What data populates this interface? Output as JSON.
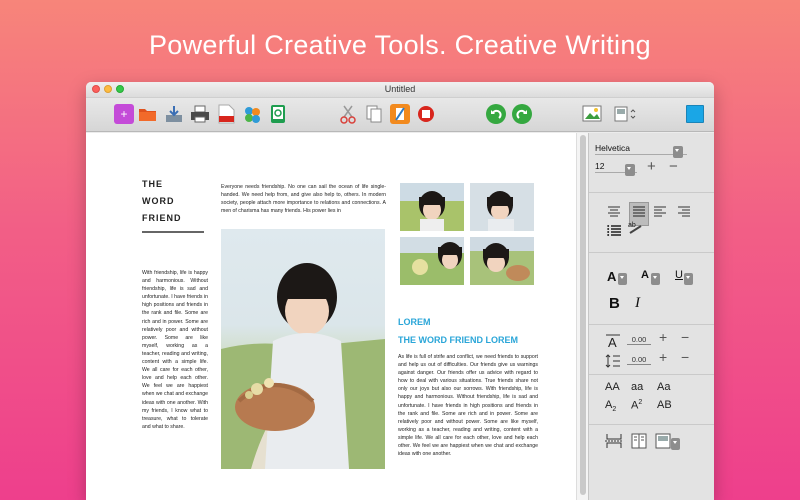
{
  "headline": "Powerful Creative Tools. Creative Writing",
  "window": {
    "title": "Untitled"
  },
  "toolbar": {
    "icons": [
      "new-document-icon",
      "open-folder-icon",
      "import-icon",
      "print-icon",
      "pdf-export-icon",
      "share-icon",
      "save-icon",
      "cut-icon",
      "copy-icon",
      "paste-icon",
      "insert-image-icon",
      "undo-icon",
      "redo-icon",
      "insert-picture-icon",
      "page-setup-icon",
      "color-swatch-icon"
    ],
    "accent": "#1aa6e6"
  },
  "document": {
    "heading_lines": [
      "THE",
      "WORD",
      "FRIEND"
    ],
    "left_column_text": "With friendship, life is happy and harmonious. Without friendship, life is sad and unfortunate. I have friends in high positions and friends in the rank and file. Some are rich and in power. Some are relatively poor and without power. Some are like myself, working as a teacher, reading and writing, content with a simple life. We all care for each other, love and help each other. We feel we are happiest when we chat and exchange ideas with one another. With my friends, I know what to treasure, what to tolerate and what to share.",
    "intro_text": "Everyone needs friendship. No one can sail the ocean of life single-handed. We need help from, and give also help to, others. In modern society, people attach more importance to relations and connections. A men of charisma has many friends. His power lies in",
    "lorem_label": "LOREM",
    "subtitle": "THE WORD FRIEND LOREM",
    "right_column_text": "As life is full of strife and conflict, we need friends to support and help us out of difficulties. Our friends give us warnings against danger. Our friends offer us advice with regard to how to deal with various situations. True friends share not only our joys but also our sorrows. With friendship, life is happy and harmonious. Without friendship, life is sad and unfortunate. I have friends in high positions and friends in the rank and file. Some are rich and in power. Some are relatively poor and without power. Some are like myself, working as a teacher, reading and writing, content with a simple life. We all care for each other, love and help each other. We feel we are happiest when we chat and exchange ideas with one another.",
    "accent_color": "#2aa6d8"
  },
  "panel": {
    "font_name": "Helvetica",
    "font_size": "12",
    "spacing_1": "0.00",
    "spacing_2": "0.00",
    "bold_label": "B",
    "italic_label": "I",
    "text_a": "A",
    "text_u": "U",
    "case_labels": [
      "AA",
      "aa",
      "Aa",
      "A",
      "A",
      "AB"
    ],
    "case_subs": [
      "2",
      "",
      "",
      "2",
      "2",
      ""
    ]
  }
}
